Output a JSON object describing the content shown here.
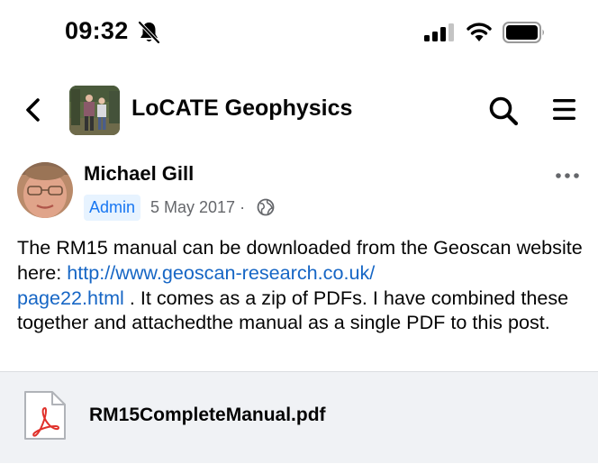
{
  "status_bar": {
    "time": "09:32"
  },
  "header": {
    "group_name": "LoCATE Geophysics"
  },
  "post": {
    "author": "Michael Gill",
    "badge": "Admin",
    "date": "5 May 2017",
    "separator": "·",
    "text_before_link": "The RM15 manual can be downloaded from the Geoscan website here:  ",
    "link_line1": "http://www.geoscan-research.co.uk/",
    "link_line2": "page22.html",
    "text_after_link": " .  It comes as a zip of PDFs.  I have combined these together and attachedthe manual as a single PDF to this post."
  },
  "attachment": {
    "filename": "RM15CompleteManual.pdf"
  },
  "colors": {
    "link": "#1666c5",
    "badge_bg": "#e7f3ff",
    "badge_text": "#1877f2",
    "pdf_red": "#e0312b"
  },
  "icons": [
    "bell-slash-icon",
    "signal-icon",
    "wifi-icon",
    "battery-icon",
    "back-chevron-icon",
    "search-icon",
    "hamburger-menu-icon",
    "more-options-icon",
    "globe-icon",
    "pdf-file-icon"
  ]
}
